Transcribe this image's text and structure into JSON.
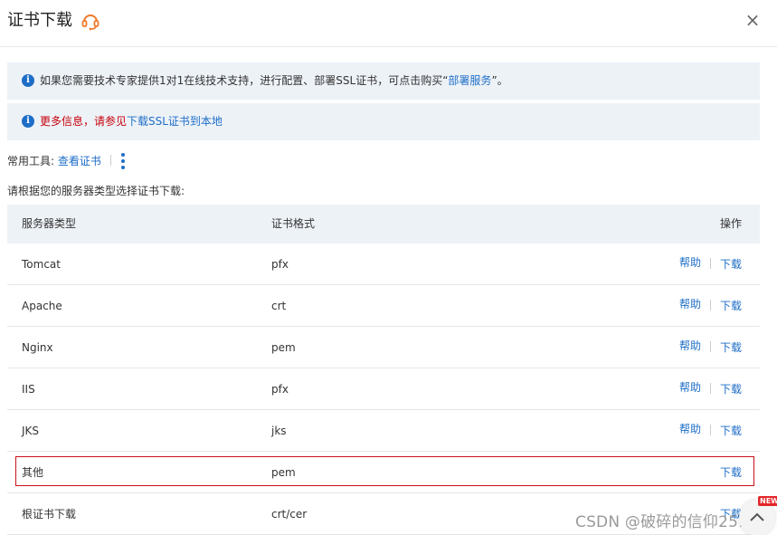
{
  "dialog": {
    "title": "证书下载",
    "close_label": "×"
  },
  "notices": [
    {
      "text_before": "如果您需要技术专家提供1对1在线技术支持，进行配置、部署SSL证书，可点击购买“",
      "link": "部署服务",
      "text_after": "”。"
    },
    {
      "text_before": "更多信息，请参见",
      "link": "下载SSL证书到本地",
      "text_after": ""
    }
  ],
  "tools": {
    "label": "常用工具:",
    "link": "查看证书"
  },
  "instruction": "请根据您的服务器类型选择证书下载:",
  "table": {
    "headers": [
      "服务器类型",
      "证书格式",
      "操作"
    ],
    "rows": [
      {
        "server": "Tomcat",
        "format": "pfx",
        "help": "帮助",
        "download": "下载"
      },
      {
        "server": "Apache",
        "format": "crt",
        "help": "帮助",
        "download": "下载"
      },
      {
        "server": "Nginx",
        "format": "pem",
        "help": "帮助",
        "download": "下载"
      },
      {
        "server": "IIS",
        "format": "pfx",
        "help": "帮助",
        "download": "下载"
      },
      {
        "server": "JKS",
        "format": "jks",
        "help": "帮助",
        "download": "下载"
      },
      {
        "server": "其他",
        "format": "pem",
        "download": "下载"
      },
      {
        "server": "根证书下载",
        "format": "crt/cer",
        "download": "下载"
      }
    ]
  },
  "watermark": "CSDN @破碎的信仰251",
  "badge": "NEW",
  "colors": {
    "link": "#1e6ec7",
    "notice_bg": "#edf2f7",
    "highlight": "#c9101a",
    "support_icon": "#f07a2b"
  }
}
